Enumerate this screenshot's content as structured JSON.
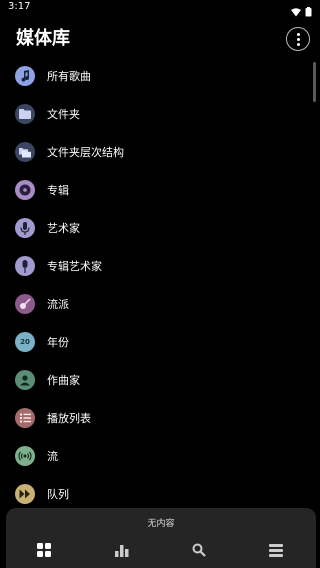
{
  "status": {
    "time": "3:17",
    "wifi_icon": "wifi-icon",
    "battery_icon": "battery-icon"
  },
  "header": {
    "title": "媒体库",
    "more_icon": "more-vert-icon"
  },
  "items": [
    {
      "label": "所有歌曲",
      "icon": "music-note-icon",
      "color": "#8ea3e6"
    },
    {
      "label": "文件夹",
      "icon": "folder-icon",
      "color": "#3b4760"
    },
    {
      "label": "文件夹层次结构",
      "icon": "folder-tree-icon",
      "color": "#3b4760"
    },
    {
      "label": "专辑",
      "icon": "album-icon",
      "color": "#a88bc7"
    },
    {
      "label": "艺术家",
      "icon": "microphone-icon",
      "color": "#a29bcf"
    },
    {
      "label": "专辑艺术家",
      "icon": "album-artist-icon",
      "color": "#a29bcf"
    },
    {
      "label": "流派",
      "icon": "guitar-icon",
      "color": "#8c5a8b"
    },
    {
      "label": "年份",
      "icon": "calendar-icon",
      "color": "#7bb0c6",
      "badge": "20"
    },
    {
      "label": "作曲家",
      "icon": "composer-icon",
      "color": "#5b8e74"
    },
    {
      "label": "播放列表",
      "icon": "playlist-icon",
      "color": "#a46b6b"
    },
    {
      "label": "流",
      "icon": "stream-icon",
      "color": "#7fb08c"
    },
    {
      "label": "队列",
      "icon": "queue-icon",
      "color": "#c9b073"
    }
  ],
  "player": {
    "now_playing": "无内容"
  },
  "nav": [
    {
      "icon": "library-grid-icon"
    },
    {
      "icon": "bar-chart-icon"
    },
    {
      "icon": "search-icon"
    },
    {
      "icon": "menu-icon"
    }
  ]
}
